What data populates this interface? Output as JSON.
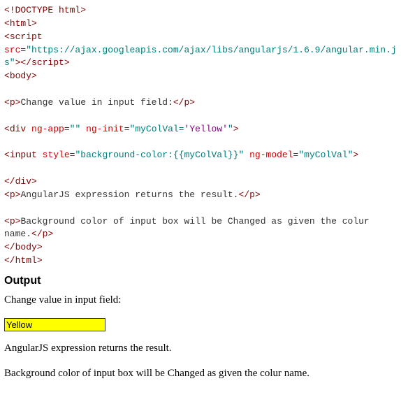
{
  "code": {
    "line1_a": "<!DOCTYPE html>",
    "line2_open": "<",
    "line2_tag": "html",
    "line2_close": ">",
    "line3_open": "<",
    "line3_tag": "script",
    "line3_sp": " ",
    "line3_attr": "src",
    "line3_eq": "=",
    "line3_val": "\"https://ajax.googleapis.com/ajax/libs/angularjs/1.6.9/angular.min.js\"",
    "line3_mid": "></",
    "line3_tag2": "script",
    "line3_end": ">",
    "line4_open": "<",
    "line4_tag": "body",
    "line4_close": ">",
    "line6_open": "<",
    "line6_tag": "p",
    "line6_close": ">",
    "line6_text": "Change value in input field:",
    "line6_end_open": "</",
    "line6_end_tag": "p",
    "line6_end_close": ">",
    "line8_open": "<",
    "line8_tag": "div",
    "line8_sp": " ",
    "line8_attr1": "ng-app",
    "line8_eq1": "=",
    "line8_val1": "\"\"",
    "line8_sp2": " ",
    "line8_attr2": "ng-init",
    "line8_eq2": "=",
    "line8_val2_q": "\"",
    "line8_val2_txt": "myColVal=",
    "line8_val2_str": "'Yellow'",
    "line8_val2_end": "\"",
    "line8_close": ">",
    "line10_open": "<",
    "line10_tag": "input",
    "line10_sp": " ",
    "line10_attr1": "style",
    "line10_eq1": "=",
    "line10_val1": "\"background-color:{{myColVal}}\"",
    "line10_sp2": " ",
    "line10_attr2": "ng-model",
    "line10_eq2": "=",
    "line10_val2": "\"myColVal\"",
    "line10_close": ">",
    "line12_open": "</",
    "line12_tag": "div",
    "line12_close": ">",
    "line13_open": "<",
    "line13_tag": "p",
    "line13_close": ">",
    "line13_text": "AngularJS expression returns the result.",
    "line13_end_open": "</",
    "line13_end_tag": "p",
    "line13_end_close": ">",
    "line15_open": "<",
    "line15_tag": "p",
    "line15_close": ">",
    "line15_text": "Background color of input box will be Changed as given the colur name.",
    "line15_end_open": "</",
    "line15_end_tag": "p",
    "line15_end_close": ">",
    "line16_open": "</",
    "line16_tag": "body",
    "line16_close": ">",
    "line17_open": "</",
    "line17_tag": "html",
    "line17_close": ">"
  },
  "output": {
    "heading": "Output",
    "p1": "Change value in input field:",
    "input_value": "Yellow",
    "input_bg": "#ffff00",
    "p2": "AngularJS expression returns the result.",
    "p3": "Background color of input box will be Changed as given the colur name."
  }
}
